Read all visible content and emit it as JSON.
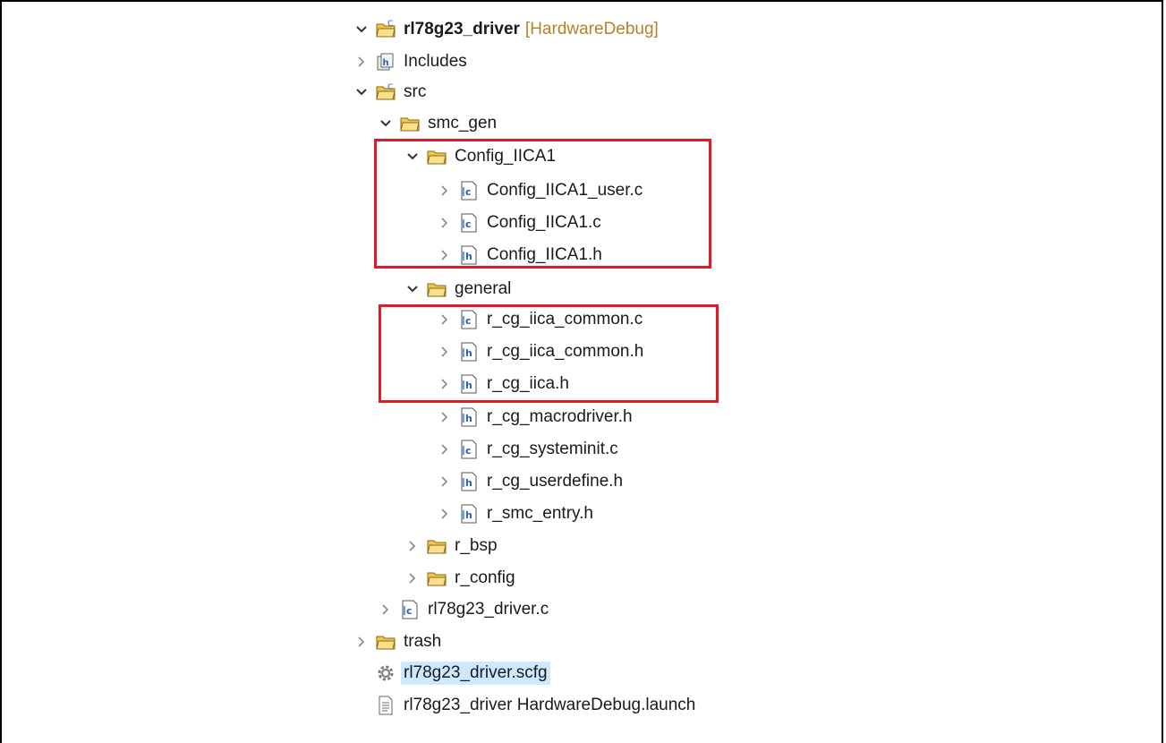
{
  "tree": {
    "project": {
      "name": "rl78g23_driver",
      "config": "[HardwareDebug]"
    },
    "includes": "Includes",
    "src": "src",
    "smc_gen": "smc_gen",
    "config_iica1": {
      "label": "Config_IICA1",
      "files": [
        "Config_IICA1_user.c",
        "Config_IICA1.c",
        "Config_IICA1.h"
      ]
    },
    "general": {
      "label": "general",
      "files": [
        "r_cg_iica_common.c",
        "r_cg_iica_common.h",
        "r_cg_iica.h",
        "r_cg_macrodriver.h",
        "r_cg_systeminit.c",
        "r_cg_userdefine.h",
        "r_smc_entry.h"
      ]
    },
    "r_bsp": "r_bsp",
    "r_config": "r_config",
    "main_c": "rl78g23_driver.c",
    "trash": "trash",
    "scfg": "rl78g23_driver.scfg",
    "launch": "rl78g23_driver HardwareDebug.launch"
  },
  "colors": {
    "highlight": "#e01b24",
    "selection": "#cde8ff",
    "folder": "#f2c54b"
  }
}
